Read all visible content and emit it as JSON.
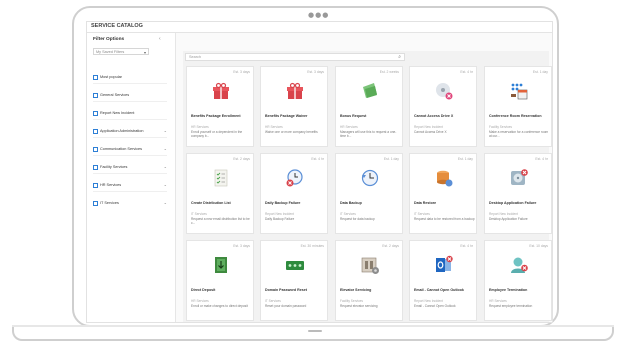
{
  "window": {
    "title": "SERVICE CATALOG"
  },
  "sidebar": {
    "header": "Filter Options",
    "saved_filter_placeholder": "My Saved Filters",
    "items": [
      {
        "label": "Most popular",
        "chevron": ""
      },
      {
        "label": "General Services",
        "chevron": ""
      },
      {
        "label": "Report New Incident",
        "chevron": ""
      },
      {
        "label": "Application Administration",
        "chevron": "⌄"
      },
      {
        "label": "Communication Services",
        "chevron": "⌄"
      },
      {
        "label": "Facility Services",
        "chevron": "⌄"
      },
      {
        "label": "HR Services",
        "chevron": "⌄"
      },
      {
        "label": "IT Services",
        "chevron": "⌄"
      }
    ]
  },
  "search": {
    "placeholder": "Search"
  },
  "cards": [
    {
      "title": "Benefits Package Enrollment",
      "subtitle": "HR Services",
      "desc": "Enroll yourself or a dependent in the company b...",
      "meta": "Est. 3 days",
      "icon": "gift-icon"
    },
    {
      "title": "Benefits Package Waiver",
      "subtitle": "HR Services",
      "desc": "Waive one or more company benefits",
      "meta": "Est. 3 days",
      "icon": "gift-icon"
    },
    {
      "title": "Bonus Request",
      "subtitle": "HR Services",
      "desc": "Managers will use this to request a one-time b...",
      "meta": "Est. 2 weeks",
      "icon": "money-icon"
    },
    {
      "title": "Cannot Access Drive X",
      "subtitle": "Report New Incident",
      "desc": "Cannot Access Drive X",
      "meta": "Est. 4 hr",
      "icon": "disk-error-icon"
    },
    {
      "title": "Conference Room Reservation",
      "subtitle": "Facility Services",
      "desc": "Make a reservation for a conference room at our...",
      "meta": "Est. 1 day",
      "icon": "calendar-icon"
    },
    {
      "title": "Create Distribution List",
      "subtitle": "IT Services",
      "desc": "Request a new email distribution list to be c...",
      "meta": "Est. 2 days",
      "icon": "checklist-icon"
    },
    {
      "title": "Daily Backup Failure",
      "subtitle": "Report New Incident",
      "desc": "Daily Backup Failure",
      "meta": "Est. 4 hr",
      "icon": "clock-error-icon"
    },
    {
      "title": "Data Backup",
      "subtitle": "IT Services",
      "desc": "Request for data backup",
      "meta": "Est. 1 day",
      "icon": "backup-clock-icon"
    },
    {
      "title": "Data Restore",
      "subtitle": "IT Services",
      "desc": "Request data to be restored from a backup",
      "meta": "Est. 1 day",
      "icon": "database-icon"
    },
    {
      "title": "Desktop Application Failure",
      "subtitle": "Report New Incident",
      "desc": "Desktop Application Failure",
      "meta": "Est. 4 hr",
      "icon": "disc-error-icon"
    },
    {
      "title": "Direct Deposit",
      "subtitle": "HR Services",
      "desc": "Enroll or make changes to direct deposit",
      "meta": "Est. 3 days",
      "icon": "deposit-icon"
    },
    {
      "title": "Domain Password Reset",
      "subtitle": "IT Services",
      "desc": "Reset your domain password",
      "meta": "Est. 30 minutes",
      "icon": "password-icon"
    },
    {
      "title": "Elevator Servicing",
      "subtitle": "Facility Services",
      "desc": "Request elevator servicing",
      "meta": "Est. 2 days",
      "icon": "elevator-icon"
    },
    {
      "title": "Email - Cannot Open Outlook",
      "subtitle": "Report New Incident",
      "desc": "Email - Cannot Open Outlook",
      "meta": "Est. 4 hr",
      "icon": "outlook-error-icon"
    },
    {
      "title": "Employee Termination",
      "subtitle": "HR Services",
      "desc": "Request employee termination",
      "meta": "Est. 10 days",
      "icon": "user-remove-icon"
    }
  ]
}
